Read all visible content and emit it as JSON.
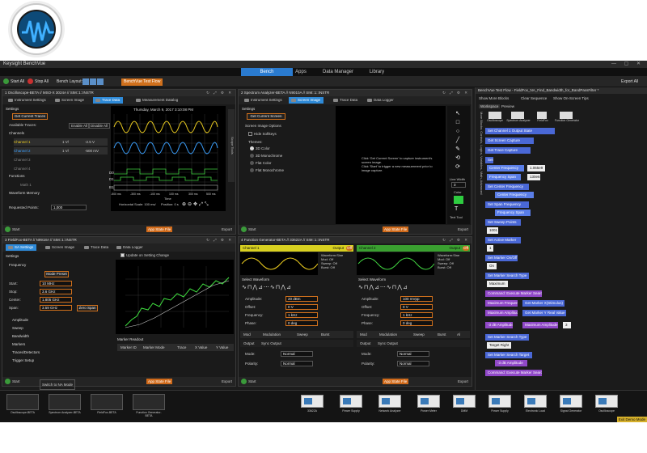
{
  "window": {
    "title": "Keysight BenchVue"
  },
  "menu": {
    "tabs": [
      "Bench",
      "Apps",
      "Data Manager",
      "Library"
    ],
    "active": "Bench"
  },
  "toolbar": {
    "start_all": "Start All",
    "stop_all": "Stop All",
    "bench_layout": "Bench Layout:",
    "test_flow": "BenchVue Test Flow",
    "export_all": "Export All"
  },
  "panels": {
    "osc": {
      "header": "1  Oscilloscope-BETA // MSO-X 3024A // SIM::1::INSTR",
      "tabs": [
        "Instrument Settings",
        "Screen Image",
        "Trace Data",
        "Measurement Datalog"
      ],
      "active_tab": "Trace Data",
      "settings": "Settings",
      "get_traces": "Get Current Traces",
      "available_traces": "Available Traces:",
      "enable_all": "Enable All",
      "disable_all": "Disable All",
      "channels_title": "Channels",
      "channels": [
        {
          "name": "Channel 1",
          "scale": "1 V/",
          "offset": "-2.5 V"
        },
        {
          "name": "Channel 2",
          "scale": "1 V/",
          "offset": "-500 mV"
        },
        {
          "name": "Channel 3",
          "scale": "",
          "offset": ""
        },
        {
          "name": "Channel 4",
          "scale": "",
          "offset": ""
        }
      ],
      "functions": "Functions",
      "math1": "Math 1",
      "waveform_memory": "Waveform Memory",
      "requested_points": "Requested Points:",
      "requested_points_value": "1,000",
      "scope_time": "Thursday, March 9, 2017 3:10:08 PM",
      "x_ticks": [
        "-500 ms",
        "-300 ms",
        "-100 ms",
        "100 ms",
        "300 ms",
        "500 ms"
      ],
      "x_label": "Time",
      "horiz_scale": "Horizontal Scale: 100 ms/",
      "position": "Position: 0 s",
      "digital": [
        "D0",
        "D1",
        "B1"
      ],
      "side_label": "Scope Tools",
      "start": "Start",
      "app_state": "App State File",
      "export": "Export"
    },
    "sa": {
      "header": "2  Spectrum Analyzer-BETA // N9010A // SIM::1::INSTR",
      "tabs": [
        "Instrument Settings",
        "Screen Image",
        "Trace Data",
        "Data Logger"
      ],
      "active_tab": "Screen Image",
      "settings": "Settings",
      "get_screen": "Get Current Screen",
      "screen_options": "Screen Image Options",
      "hide_softkeys": "Hide Softkeys",
      "themes": "Themes:",
      "theme_options": [
        "3D Color",
        "3D Monochrome",
        "Flat Color",
        "Flat Monochrome"
      ],
      "message": "Click 'Get Current Screen' to capture instrument's screen image.",
      "message2": "Click 'Start' to trigger a new measurement prior to image capture.",
      "line_width": "Line Width",
      "line_width_value": "3",
      "color": "Color",
      "text_tool": "Text Tool",
      "start": "Start",
      "app_state": "App State File",
      "export": "Export"
    },
    "ff": {
      "header": "3  FieldFox-BETA // N9918A // SIM::1::INSTR",
      "tabs": [
        "SA Settings",
        "Screen Image",
        "Trace Data",
        "Data Logger"
      ],
      "active_tab": "SA Settings",
      "settings": "Settings",
      "frequency": "Frequency",
      "mode_preset": "Mode Preset",
      "fields": [
        {
          "label": "Start:",
          "value": "10 MHz"
        },
        {
          "label": "Stop:",
          "value": "3.6 GHz"
        },
        {
          "label": "Center:",
          "value": "1.805 GHz"
        },
        {
          "label": "Span:",
          "value": "3.59 GHz"
        }
      ],
      "zero_span": "Zero Span",
      "sections": [
        "Amplitude",
        "Sweep",
        "Bandwidth",
        "Markers",
        "Traces/Detectors",
        "Trigger Setup"
      ],
      "update_on_change": "Update on Setting Change",
      "marker_readout": "Marker Readout",
      "marker_cols": [
        "Marker ID",
        "Marker Mode",
        "Trace",
        "X Value",
        "Y Value"
      ],
      "start": "Start",
      "switch_na": "Switch to NA Mode",
      "app_state": "App State File",
      "export": "Export"
    },
    "fg": {
      "header": "4  Function Generator-BETA // 33622A // SIM::1::INSTR",
      "ch1": "Channel 1",
      "ch2": "Channel 2",
      "output": "Output",
      "off": "Off",
      "info_lines": [
        "Waveform:Sine",
        "Mod: Off",
        "Sweep: Off",
        "Burst: Off"
      ],
      "select_waveform": "Select Waveform",
      "ch1_fields": [
        {
          "label": "Amplitude:",
          "value": "20 dBm"
        },
        {
          "label": "Offset:",
          "value": "0 V"
        },
        {
          "label": "Frequency:",
          "value": "1 kHz"
        },
        {
          "label": "Phase:",
          "value": "0 deg"
        }
      ],
      "ch2_fields": [
        {
          "label": "Amplitude:",
          "value": "100 mVpp"
        },
        {
          "label": "Offset:",
          "value": "0 V"
        },
        {
          "label": "Frequency:",
          "value": "1 kHz"
        },
        {
          "label": "Phase:",
          "value": "0 deg"
        }
      ],
      "mod_tabs": [
        "Mod",
        "Modulation",
        "Sweep",
        "Burst",
        "Al"
      ],
      "output_tabs": [
        "Output",
        "Sync Output"
      ],
      "mode_label": "Mode:",
      "mode_value": "Normal",
      "polarity_label": "Polarity:",
      "polarity_value": "Normal",
      "start": "Start",
      "app_state": "App State File",
      "export": "Export"
    }
  },
  "flow": {
    "title": "BenchVue Test Flow - FieldFox_NA_Find_Bandwidth_for_BandPassFilter *",
    "show_more": "Show More Blocks",
    "clear_sequence": "Clear Sequence",
    "show_tips": "Show On-Screen Tips",
    "tabs": [
      "Workspace",
      "Preview"
    ],
    "side_label": "More Blocks: Controls, Logics, Variables, Math, Advanced",
    "instruments": [
      "Oscilloscope",
      "Spectrum Analyzer",
      "FieldFox",
      "Function Generator"
    ],
    "blocks": [
      "Set Channel 1 Output State",
      "Get Screen Capture",
      "Get Trace Capture",
      "Set",
      "Center Frequency",
      "1.065e9",
      "Frequency Span",
      "130e6",
      "Set Center Frequency",
      "Center Frequency",
      "Set Span Frequency",
      "Frequency Span",
      "Set Sweep Points",
      "1001",
      "Set Active Marker",
      "1",
      "Set Marker On/Off",
      "On",
      "Set Marker Search Type",
      "Maximum",
      "Command: Execute Marker Search",
      "Maximum Frequency",
      "Get Marker X(Stimulus)",
      "Maximum Amplitude",
      "Get Marker Y Real Value",
      "-3 dB Amplitude",
      "Maximum Amplitude",
      "3",
      "Set Marker Search Type",
      "Target Right",
      "Set Marker Search Target",
      "-3 dB Amplitude",
      "Command: Execute Marker Search"
    ]
  },
  "dock": {
    "apps": [
      "Oscilloscope-BETA",
      "Spectrum Analyzer-BETA",
      "FieldFox-BETA",
      "Function Generator-BETA"
    ],
    "instruments": [
      "33622A",
      "Power Supply",
      "Network Analyzer",
      "Power Meter",
      "DMM",
      "Power Supply",
      "Electronic Load",
      "Signal Generator",
      "Oscilloscope"
    ],
    "exit_demo": "Exit Demo Mode"
  },
  "colors": {
    "accent": "#2e8ad8",
    "orange": "#d0701c",
    "ch1": "#f0d020",
    "ch2": "#3aa0ff",
    "trace_green": "#40d040"
  }
}
